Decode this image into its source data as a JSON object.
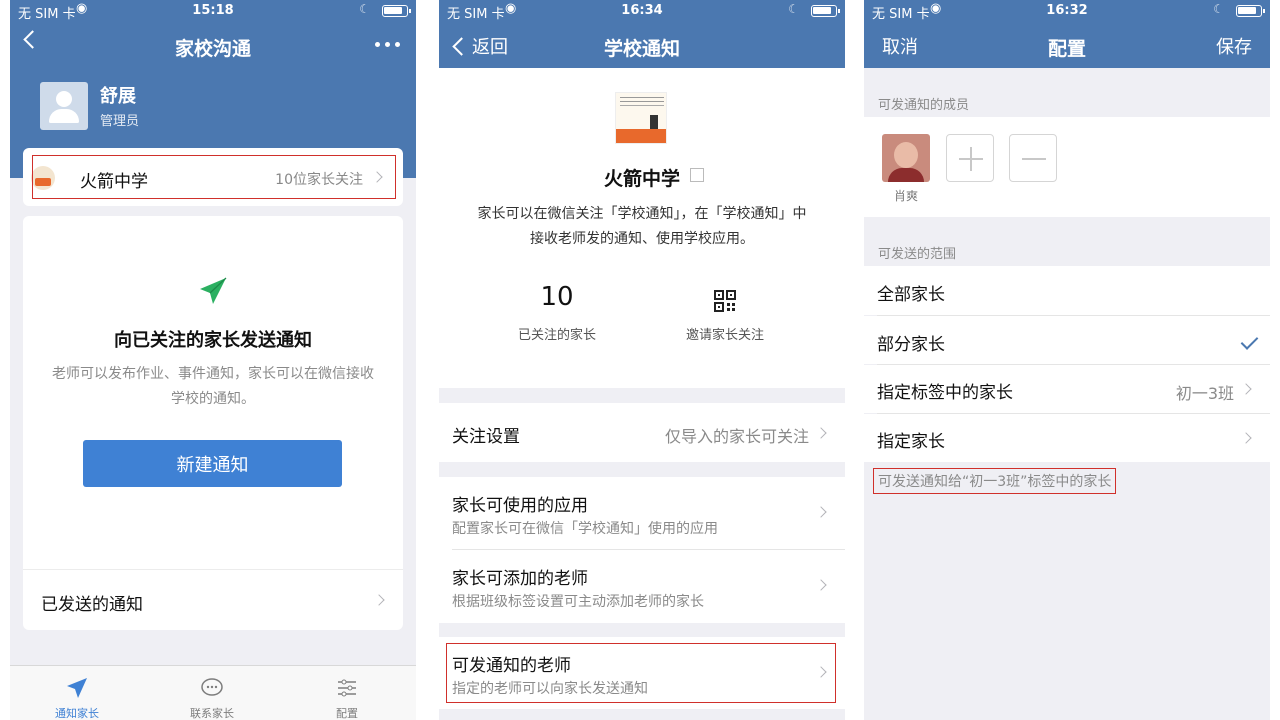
{
  "status_bar": {
    "carrier": "无 SIM 卡"
  },
  "phone1": {
    "time": "15:18",
    "title": "家校沟通",
    "admin": {
      "name": "舒展",
      "role": "管理员"
    },
    "school": {
      "name": "火箭中学",
      "follow_text": "10位家长关注"
    },
    "main": {
      "heading": "向已关注的家长发送通知",
      "desc": "老师可以发布作业、事件通知，家长可以在微信接收学校的通知。",
      "new_button": "新建通知",
      "sent_label": "已发送的通知"
    },
    "tabs": [
      {
        "label": "通知家长",
        "icon": "paper-plane-icon"
      },
      {
        "label": "联系家长",
        "icon": "chat-bubble-icon"
      },
      {
        "label": "配置",
        "icon": "sliders-icon"
      }
    ]
  },
  "phone2": {
    "time": "16:34",
    "back_label": "返回",
    "title": "学校通知",
    "school_name": "火箭中学",
    "desc": "家长可以在微信关注「学校通知」，在「学校通知」中接收老师发的通知、使用学校应用。",
    "followers_count": "10",
    "followers_label": "已关注的家长",
    "invite_label": "邀请家长关注",
    "rows": {
      "follow_settings": {
        "title": "关注设置",
        "value": "仅导入的家长可关注"
      },
      "apps": {
        "title": "家长可使用的应用",
        "sub": "配置家长可在微信「学校通知」使用的应用"
      },
      "teachers_add": {
        "title": "家长可添加的老师",
        "sub": "根据班级标签设置可主动添加老师的家长"
      },
      "notify_teachers": {
        "title": "可发通知的老师",
        "sub": "指定的老师可以向家长发送通知"
      }
    }
  },
  "phone3": {
    "time": "16:32",
    "cancel_label": "取消",
    "title": "配置",
    "save_label": "保存",
    "members_header": "可发通知的成员",
    "member_name": "肖爽",
    "scope_header": "可发送的范围",
    "scope_options": [
      {
        "label": "全部家长",
        "value": "",
        "selected": false
      },
      {
        "label": "部分家长",
        "value": "",
        "selected": true
      },
      {
        "label": "指定标签中的家长",
        "value": "初一3班",
        "selected": false
      },
      {
        "label": "指定家长",
        "value": "",
        "selected": false
      }
    ],
    "note": "可发送通知给“初一3班”标签中的家长"
  },
  "colors": {
    "accent": "#4b78b0",
    "button": "#3f81d4",
    "highlight_box": "#d0302b",
    "send_icon": "#2bb061"
  }
}
